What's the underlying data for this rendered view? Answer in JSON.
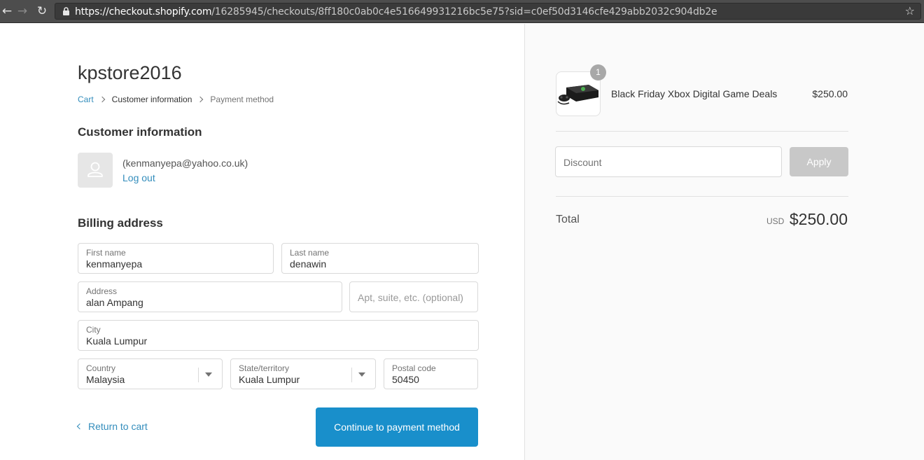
{
  "browser": {
    "url_host": "https://checkout.shopify.com",
    "url_path": "/16285945/checkouts/8ff180c0ab0c4e516649931216bc5e75?sid=c0ef50d3146cfe429abb2032c904db2e",
    "back_glyph": "←",
    "forward_glyph": "→",
    "reload_glyph": "↻",
    "star_glyph": "☆"
  },
  "shop": {
    "name": "kpstore2016"
  },
  "breadcrumb": {
    "items": [
      "Cart",
      "Customer information",
      "Payment method"
    ]
  },
  "customer": {
    "heading": "Customer information",
    "email": "(kenmanyepa@yahoo.co.uk)",
    "logout_label": "Log out"
  },
  "billing": {
    "heading": "Billing address",
    "first_name": {
      "label": "First name",
      "value": "kenmanyepa"
    },
    "last_name": {
      "label": "Last name",
      "value": "denawin"
    },
    "address": {
      "label": "Address",
      "value": "alan Ampang"
    },
    "apartment": {
      "placeholder": "Apt, suite, etc. (optional)"
    },
    "city": {
      "label": "City",
      "value": "Kuala Lumpur"
    },
    "country": {
      "label": "Country",
      "value": "Malaysia"
    },
    "state": {
      "label": "State/territory",
      "value": "Kuala Lumpur"
    },
    "postal": {
      "label": "Postal code",
      "value": "50450"
    }
  },
  "actions": {
    "return_label": "Return to cart",
    "continue_label": "Continue to payment method"
  },
  "order": {
    "item": {
      "name": "Black Friday Xbox Digital Game Deals",
      "price": "$250.00",
      "quantity": "1"
    },
    "discount_placeholder": "Discount",
    "apply_label": "Apply",
    "total_label": "Total",
    "currency": "USD",
    "total": "$250.00"
  },
  "colors": {
    "link": "#338dbc",
    "primary_button": "#198fcb",
    "disabled_button": "#c8c8c8"
  }
}
